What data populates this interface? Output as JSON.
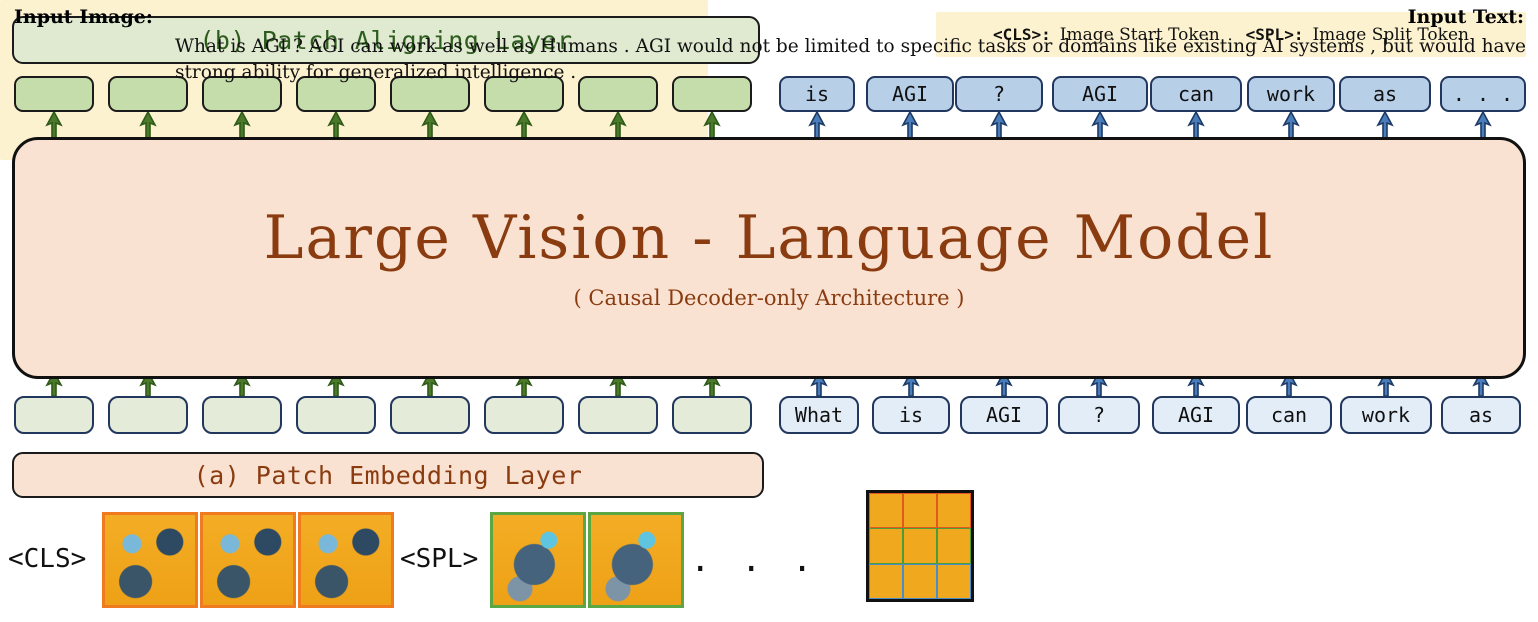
{
  "diagram": {
    "patch_aligning_layer": "(b) Patch Aligning Layer",
    "patch_embedding_layer": "(a) Patch Embedding Layer",
    "model_title": "Large Vision - Language Model",
    "model_subtitle": "( Causal Decoder-only Architecture )"
  },
  "legend": {
    "cls_token": "<CLS>:",
    "cls_desc": "Image Start Token",
    "spl_token": "<SPL>:",
    "spl_desc": "Image Split Token"
  },
  "output_tokens": {
    "vision_count": 8,
    "text": [
      "is",
      "AGI",
      "?",
      "AGI",
      "can",
      "work",
      "as",
      ". . ."
    ]
  },
  "input_tokens": {
    "vision_count": 8,
    "text": [
      "What",
      "is",
      "AGI",
      "?",
      "AGI",
      "can",
      "work",
      "as"
    ]
  },
  "patch_strip": {
    "cls_label": "<CLS>",
    "spl_label": "<SPL>",
    "ellipsis": ". . .",
    "orange_patches": 3,
    "green_patches": 2
  },
  "input_panel": {
    "image_label": "Input Image:",
    "text_label": "Input Text:",
    "text": "What is AGI ? AGI can work as well as Humans . AGI would not be limited to specific tasks or domains like existing AI systems , but would have strong ability for generalized intelligence ."
  },
  "colors": {
    "vision_top_fill": "#c5dcab",
    "vision_bottom_fill": "#e4ecd9",
    "text_top_fill": "#b8cfe8",
    "text_bottom_fill": "#e3edf8",
    "model_fill": "#f9e2d2",
    "model_text": "#8a3c10",
    "aligning_fill": "#dfead0",
    "aligning_text": "#2e5c1e",
    "panel_fill": "#fdf2cf",
    "green_arrow": "#4a7a2a",
    "blue_arrow": "#4a7ebb"
  }
}
